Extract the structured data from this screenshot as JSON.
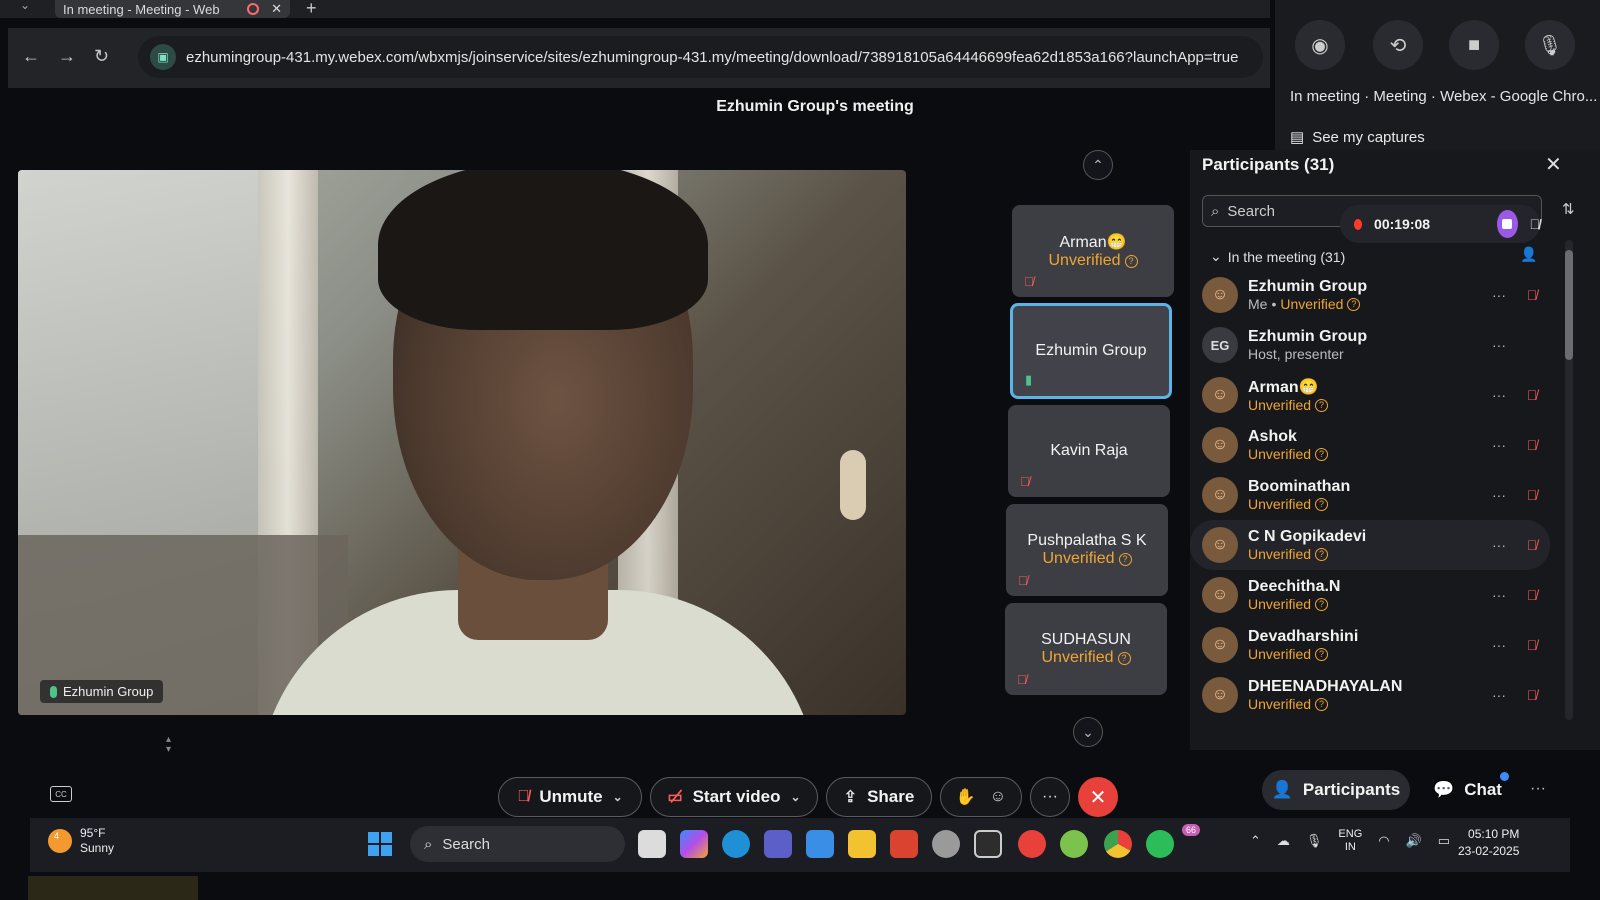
{
  "browser": {
    "tab_title": "In meeting - Meeting - Web",
    "url": "ezhumingroup-431.my.webex.com/wbxmjs/joinservice/sites/ezhumingroup-431.my/meeting/download/738918105a64446699fea62d1853a166?launchApp=true"
  },
  "capture_panel": {
    "title": "In meeting · Meeting · Webex - Google Chro...",
    "see_captures": "See my captures"
  },
  "meeting": {
    "title": "Ezhumin Group's meeting",
    "main_video_name": "Ezhumin Group"
  },
  "filmstrip": [
    {
      "name": "Arman😁",
      "status": "Unverified"
    },
    {
      "name": "Ezhumin Group",
      "status": ""
    },
    {
      "name": "Kavin Raja",
      "status": ""
    },
    {
      "name": "Pushpalatha S K",
      "status": "Unverified"
    },
    {
      "name": "SUDHASUN",
      "status": "Unverified"
    }
  ],
  "participants": {
    "header": "Participants (31)",
    "search_placeholder": "Search",
    "recording_time": "00:19:08",
    "section_label": "In the meeting (31)",
    "list": [
      {
        "name": "Ezhumin Group",
        "role": "Me",
        "status": "Unverified"
      },
      {
        "name": "Ezhumin Group",
        "initials": "EG",
        "role": "Host, presenter",
        "status": ""
      },
      {
        "name": "Arman😁",
        "role": "",
        "status": "Unverified"
      },
      {
        "name": "Ashok",
        "role": "",
        "status": "Unverified"
      },
      {
        "name": "Boominathan",
        "role": "",
        "status": "Unverified"
      },
      {
        "name": "C N Gopikadevi",
        "role": "",
        "status": "Unverified"
      },
      {
        "name": "Deechitha.N",
        "role": "",
        "status": "Unverified"
      },
      {
        "name": "Devadharshini",
        "role": "",
        "status": "Unverified"
      },
      {
        "name": "DHEENADHAYALAN",
        "role": "",
        "status": "Unverified"
      }
    ]
  },
  "controls": {
    "unmute": "Unmute",
    "start_video": "Start video",
    "share": "Share",
    "participants": "Participants",
    "chat": "Chat"
  },
  "taskbar": {
    "temp": "95°F",
    "weather": "Sunny",
    "weather_badge": "4",
    "search": "Search",
    "lang_1": "ENG",
    "lang_2": "IN",
    "time": "05:10 PM",
    "date": "23-02-2025",
    "whatsapp_badge": "66"
  },
  "colors": {
    "unverified": "#f0a533",
    "active_tile": "#5ab4e8",
    "leave": "#e8403a",
    "record": "#ff3b30"
  }
}
